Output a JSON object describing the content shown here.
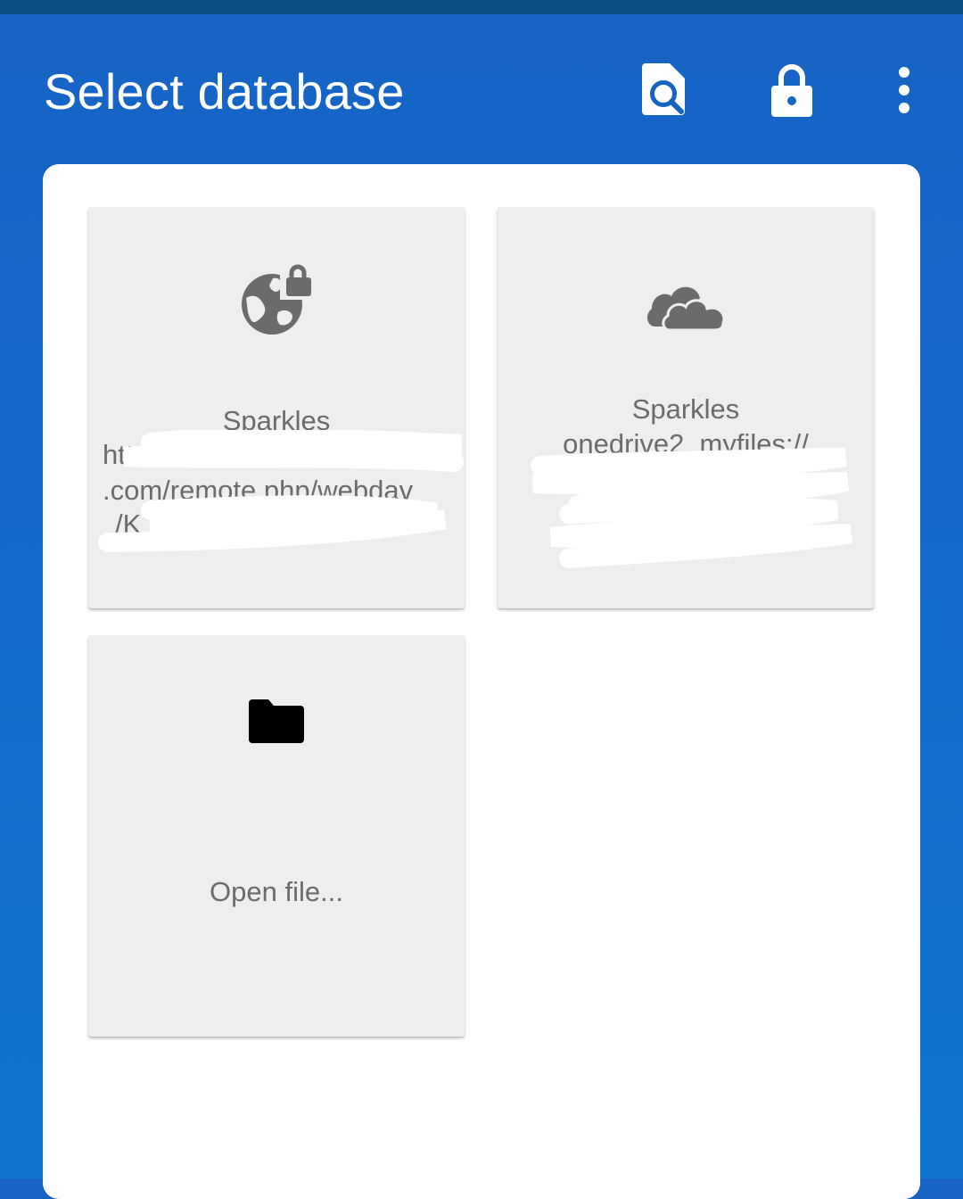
{
  "app_bar": {
    "title": "Select database",
    "actions": [
      {
        "name": "search-file",
        "icon": "file-search-icon"
      },
      {
        "name": "lock",
        "icon": "lock-icon"
      },
      {
        "name": "more-options",
        "icon": "more-vert-icon"
      }
    ],
    "color": "#1565c0"
  },
  "databases": [
    {
      "icon": "webdav-globe-lock-icon",
      "name": "Sparkles",
      "path_lines": [
        "htt",
        ".com/remote.php/webdav",
        "/K"
      ]
    },
    {
      "icon": "onedrive-cloud-icon",
      "name": "Sparkles",
      "path_lines": [
        "onedrive2_myfiles://"
      ]
    }
  ],
  "open_file": {
    "icon": "folder-icon",
    "label": "Open file..."
  },
  "colors": {
    "card_background": "#eeeeee",
    "card_text": "#6b6b6b",
    "panel": "#ffffff"
  }
}
